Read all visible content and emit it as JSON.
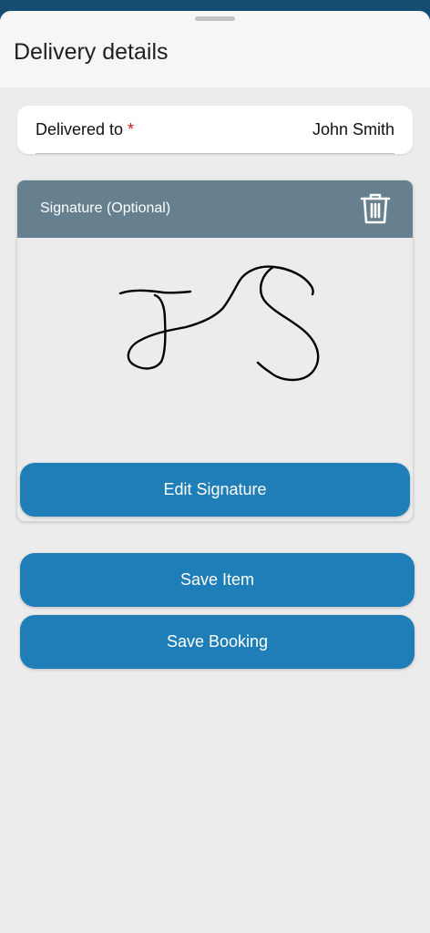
{
  "sheet": {
    "title": "Delivery details"
  },
  "delivered_to": {
    "label": "Delivered to",
    "required_marker": "*",
    "value": "John Smith"
  },
  "signature": {
    "title": "Signature (Optional)",
    "delete_icon": "trash-icon",
    "edit_label": "Edit Signature"
  },
  "actions": {
    "save_item_label": "Save Item",
    "save_booking_label": "Save Booking"
  },
  "colors": {
    "status_bar": "#154d72",
    "signature_header": "#66808f",
    "primary_button": "#1f7eb8",
    "required": "#d11a1a"
  }
}
